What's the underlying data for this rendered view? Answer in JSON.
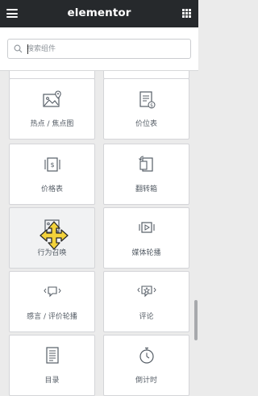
{
  "header": {
    "logo": "elementor",
    "menu_icon": "hamburger-menu-icon",
    "apps_icon": "grid-apps-icon"
  },
  "search": {
    "placeholder": "搜索组件",
    "value": ""
  },
  "widgets": [
    {
      "label": "",
      "icon": "partial-widget"
    },
    {
      "label": "",
      "icon": "partial-widget"
    },
    {
      "label": "热点 / 焦点图",
      "icon": "hotspot-image-icon"
    },
    {
      "label": "价位表",
      "icon": "price-list-icon"
    },
    {
      "label": "价格表",
      "icon": "price-table-icon"
    },
    {
      "label": "翻转箱",
      "icon": "flip-box-icon"
    },
    {
      "label": "行为召唤",
      "icon": "call-to-action-icon"
    },
    {
      "label": "媒体轮播",
      "icon": "media-carousel-icon"
    },
    {
      "label": "感言 / 评价轮播",
      "icon": "testimonial-carousel-icon"
    },
    {
      "label": "评论",
      "icon": "reviews-icon"
    },
    {
      "label": "目录",
      "icon": "table-of-contents-icon"
    },
    {
      "label": "倒计时",
      "icon": "countdown-icon"
    }
  ],
  "colors": {
    "topbar": "#26292c",
    "panel": "#ebebeb",
    "card": "#ffffff",
    "text": "#555d66"
  }
}
